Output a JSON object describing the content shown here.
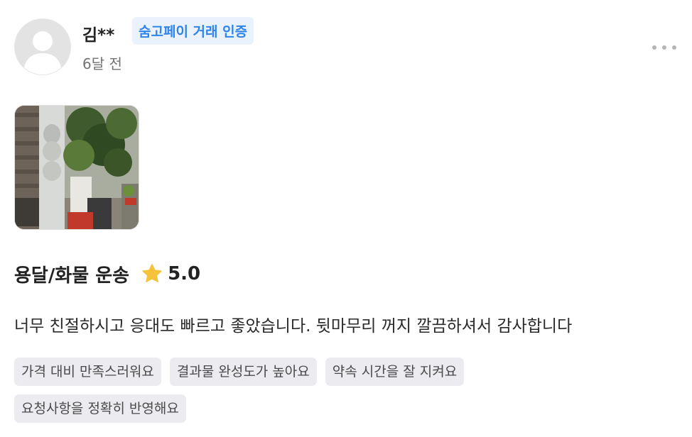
{
  "reviewer": {
    "name": "김**",
    "badge": "숨고페이 거래 인증",
    "time": "6달 전"
  },
  "photo": {
    "alt": "review-photo"
  },
  "service": {
    "name": "용달/화물 운송",
    "rating": "5.0",
    "star_color": "#f7c23b"
  },
  "review_text": "너무 친절하시고 응대도 빠르고 좋았습니다. 뒷마무리 꺼지 깔끔하셔서 감사합니다",
  "tags": [
    "가격 대비 만족스러워요",
    "결과물 완성도가 높아요",
    "약속 시간을 잘 지켜요",
    "요청사항을 정확히 반영해요"
  ],
  "colors": {
    "badge_text": "#3083e8",
    "badge_bg": "#eaf3fd",
    "tag_bg": "#ececf0"
  }
}
